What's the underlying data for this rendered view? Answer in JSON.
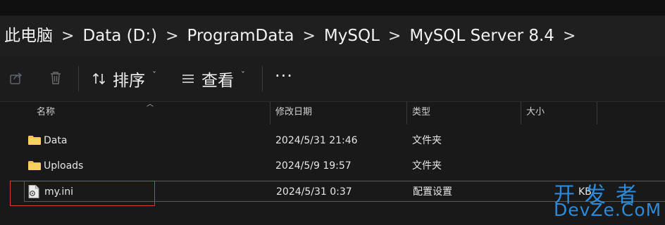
{
  "breadcrumb": {
    "items": [
      "此电脑",
      "Data (D:)",
      "ProgramData",
      "MySQL",
      "MySQL Server 8.4"
    ],
    "separator": ">"
  },
  "toolbar": {
    "share_icon": "share-icon",
    "delete_icon": "trash-icon",
    "sort_label": "排序",
    "view_label": "查看",
    "more_label": "···",
    "chevron": "ˇ"
  },
  "columns": {
    "name": "名称",
    "date": "修改日期",
    "type": "类型",
    "size": "大小"
  },
  "files": [
    {
      "name": "Data",
      "date": "2024/5/31 21:46",
      "type": "文件夹",
      "size": "",
      "icon": "folder-icon"
    },
    {
      "name": "Uploads",
      "date": "2024/5/9 19:57",
      "type": "文件夹",
      "size": "",
      "icon": "folder-icon"
    },
    {
      "name": "my.ini",
      "date": "2024/5/31 0:37",
      "type": "配置设置",
      "size": "KB",
      "icon": "config-file-icon"
    }
  ],
  "watermark": {
    "line1": "开发者",
    "line2": "DevZe.CoM"
  },
  "colors": {
    "background": "#191919",
    "folder": "#f3c44a",
    "highlight_box": "#d23a3a",
    "watermark": "#2c8ad8"
  }
}
